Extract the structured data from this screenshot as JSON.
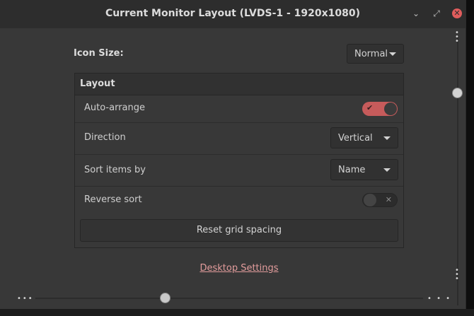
{
  "window": {
    "title": "Current Monitor Layout (LVDS-1 - 1920x1080)",
    "controls": {
      "minimize": "⌄",
      "maximize": "⤢",
      "close": "✕"
    }
  },
  "icon_size": {
    "label": "Icon Size:",
    "value": "Normal"
  },
  "layout": {
    "header": "Layout",
    "auto_arrange": {
      "label": "Auto-arrange",
      "enabled": true,
      "mark": "✔"
    },
    "direction": {
      "label": "Direction",
      "value": "Vertical"
    },
    "sort_by": {
      "label": "Sort items by",
      "value": "Name"
    },
    "reverse_sort": {
      "label": "Reverse sort",
      "enabled": false,
      "mark": "✕"
    },
    "reset_button": "Reset grid spacing"
  },
  "desktop_settings_link": "Desktop Settings",
  "accent_color": "#c65b5b",
  "link_color": "#e29c9c"
}
